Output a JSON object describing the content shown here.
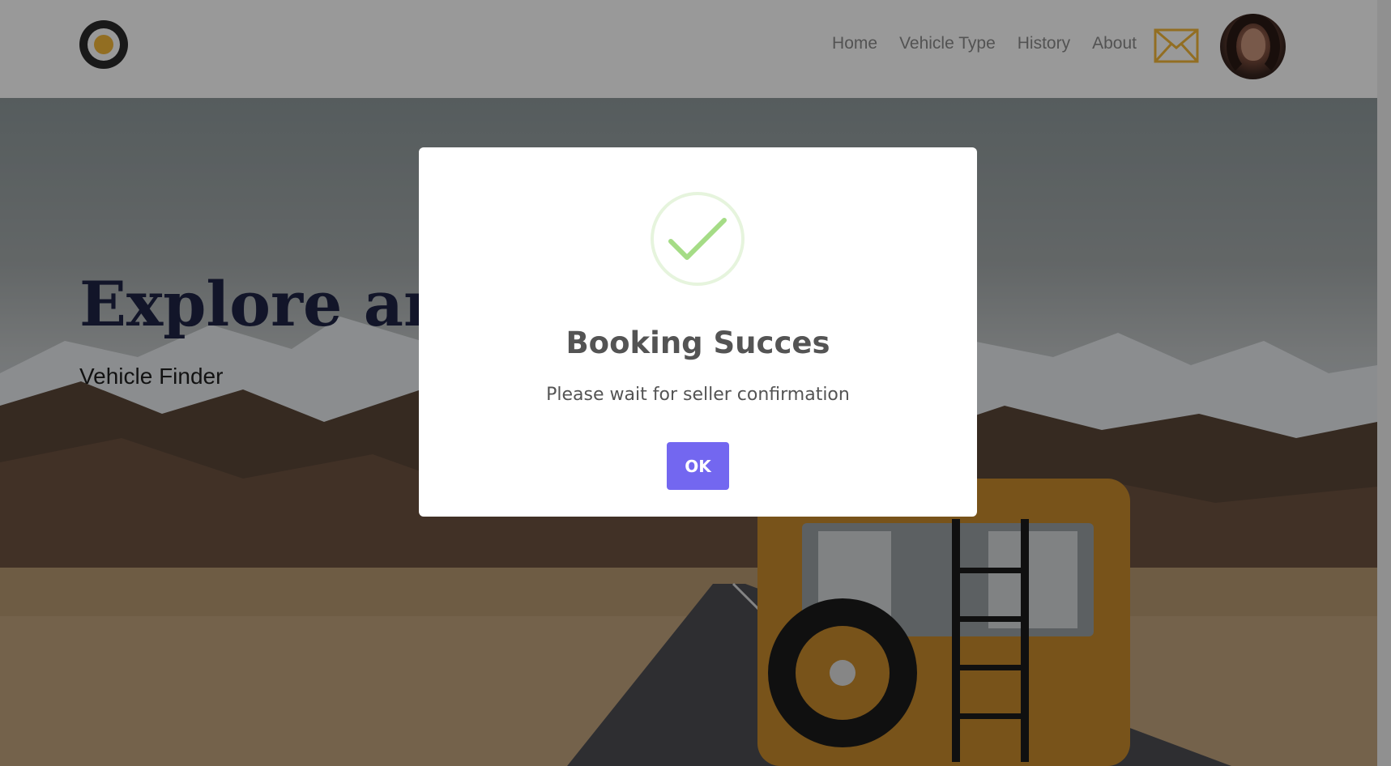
{
  "nav": {
    "logo_icon": "circle-logo-icon",
    "links": [
      "Home",
      "Vehicle Type",
      "History",
      "About"
    ],
    "mail_icon": "envelope-icon",
    "mail_color": "#f4b83a"
  },
  "hero": {
    "title": "Explore and",
    "subtitle": "Vehicle Finder"
  },
  "modal": {
    "icon": "check-circle-icon",
    "icon_color": "#a5dc86",
    "title": "Booking Succes",
    "text": "Please wait for seller confirmation",
    "ok_label": "OK",
    "button_color": "#7367f0"
  }
}
